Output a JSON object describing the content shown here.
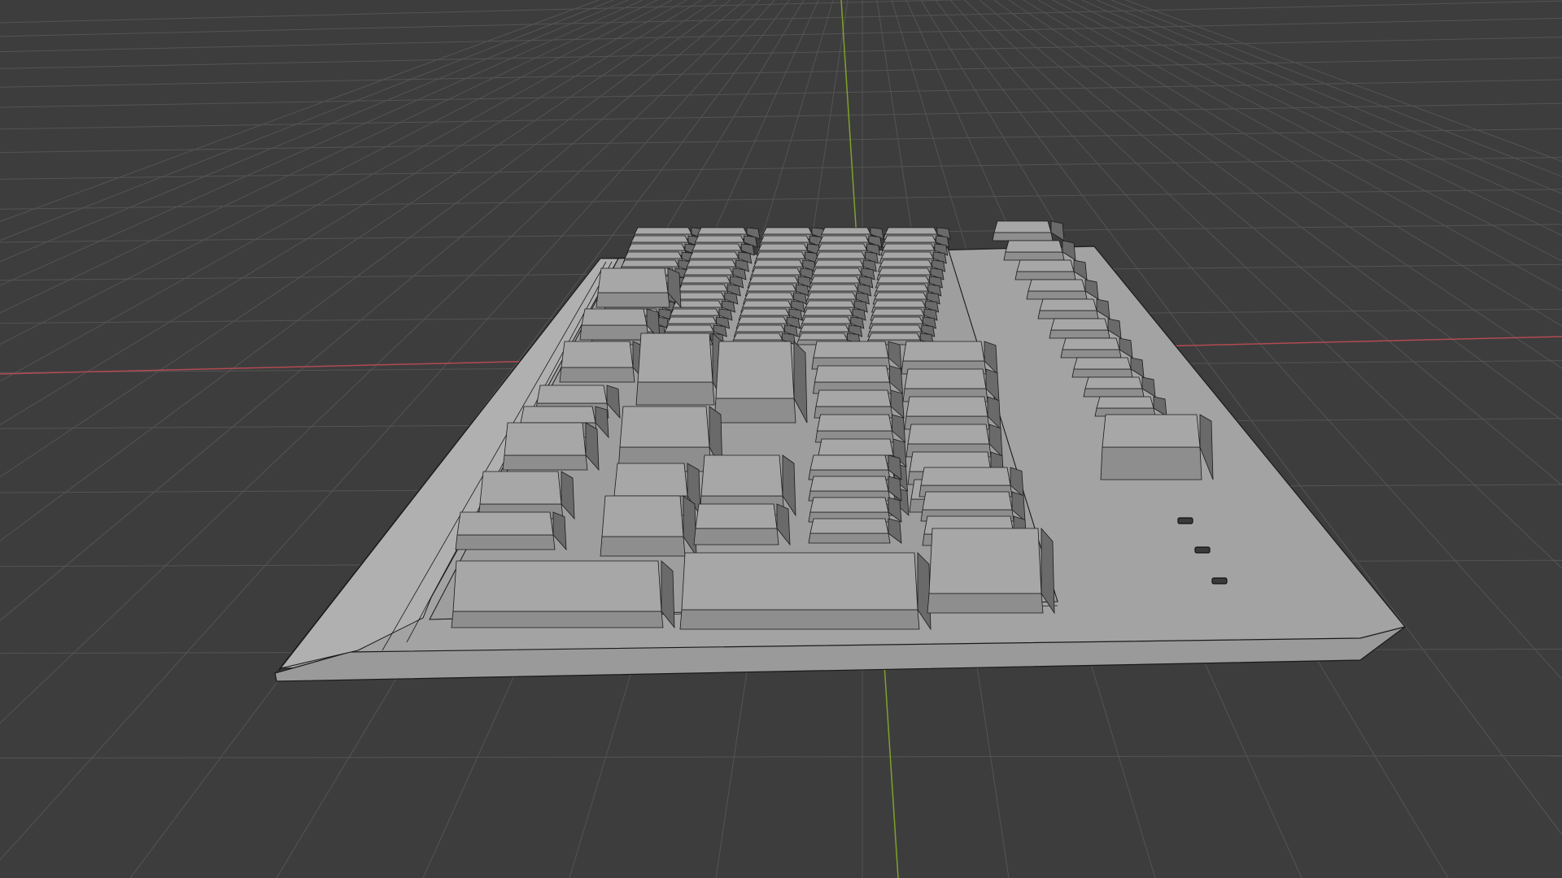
{
  "viewport": {
    "background_color": "#3d3d3d",
    "grid_color": "#545454",
    "x_axis_color": "#b24a52",
    "y_axis_color": "#7fa12a",
    "shading_mode": "solid",
    "object": "keyboard-mesh"
  },
  "mesh": {
    "base_color": "#a6a6a6",
    "keycap_top_color": "#a7a7a7",
    "keycap_side_color": "#6a6a6a",
    "edge_color": "#1a1a1a"
  }
}
